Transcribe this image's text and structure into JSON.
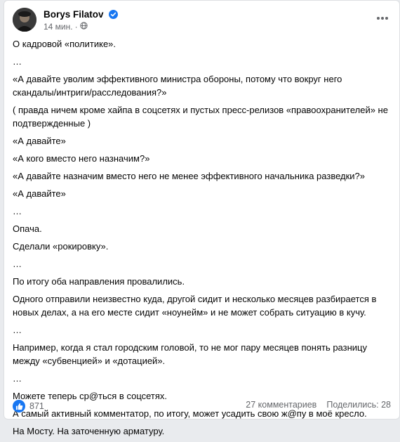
{
  "post": {
    "author": "Borys Filatov",
    "time": "14 мин.",
    "separator": "·",
    "paragraphs": [
      "О кадровой «политике».",
      "…",
      "«А давайте уволим эффективного министра обороны, потому что вокруг него скандалы/интриги/расследования?»",
      "( правда  ничем кроме хайпа в соцсетях и пустых пресс-релизов «правоохранителей» не подтвержденные )",
      "«А давайте»",
      "«А кого вместо него назначим?»",
      "«А давайте назначим вместо него не менее эффективного начальника разведки?»",
      "«А давайте»",
      "…",
      "Опача.",
      "Сделали «рокировку».",
      "…",
      "По итогу оба направления провалились.",
      "Одного отправили неизвестно куда, другой сидит и несколько месяцев разбирается в новых делах, а на его месте сидит «ноунейм» и не может собрать ситуацию в кучу.",
      "…",
      "Например, когда я стал городским головой,  то не мог пару месяцев понять разницу между «субвенцией» и «дотацией».",
      "…",
      "Можете теперь ср@ться в соцсетях.",
      "А самый активный комментатор, по итогу, может усадить свою ж@пу в моё кресло.",
      "На Мосту. На заточенную арматуру."
    ]
  },
  "footer": {
    "reactions_count": "871",
    "comments": "27 комментариев",
    "shares": "Поделились: 28"
  },
  "colors": {
    "accent": "#1877f2",
    "secondary_text": "#65676b",
    "primary_text": "#050505"
  },
  "icons": {
    "verified": "verified-badge-icon",
    "audience": "globe-icon",
    "more": "more-options-icon",
    "like": "like-icon"
  }
}
